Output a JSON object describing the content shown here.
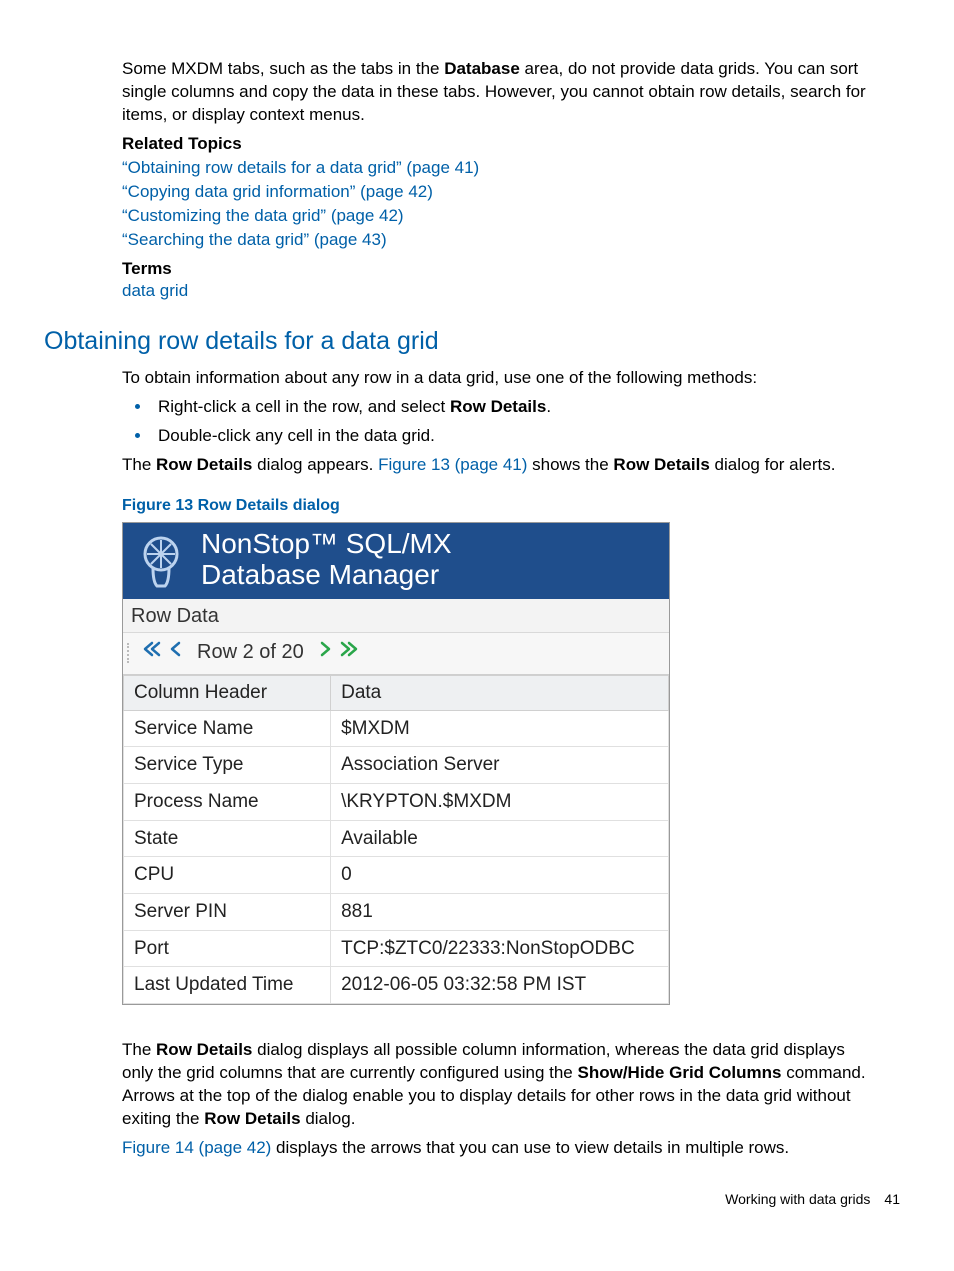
{
  "intro": {
    "p1_a": "Some MXDM tabs, such as the tabs in the ",
    "p1_bold": "Database",
    "p1_b": " area, do not provide data grids. You can sort single columns and copy the data in these tabs. However, you cannot obtain row details, search for items, or display context menus."
  },
  "related": {
    "heading": "Related Topics",
    "links": [
      "“Obtaining row details for a data grid” (page 41)",
      "“Copying data grid information” (page 42)",
      "“Customizing the data grid” (page 42)",
      "“Searching the data grid” (page 43)"
    ],
    "terms_heading": "Terms",
    "terms_link": "data grid"
  },
  "section": {
    "title": "Obtaining row details for a data grid",
    "lead": "To obtain information about any row in a data grid, use one of the following methods:",
    "methods": [
      {
        "a": "Right-click a cell in the row, and select ",
        "bold": "Row Details",
        "b": "."
      },
      {
        "a": "Double-click any cell in the data grid.",
        "bold": "",
        "b": ""
      }
    ],
    "appears_a": "The ",
    "appears_bold1": "Row Details",
    "appears_b": " dialog appears. ",
    "appears_link": "Figure 13 (page 41)",
    "appears_c": " shows the ",
    "appears_bold2": "Row Details",
    "appears_d": " dialog for alerts."
  },
  "figure": {
    "caption": "Figure 13 Row Details dialog",
    "banner_line1": "NonStop™ SQL/MX",
    "banner_line2": "Database Manager",
    "rowdata_label": "Row Data",
    "row_counter": "Row 2 of 20",
    "table_headers": [
      "Column Header",
      "Data"
    ],
    "rows": [
      [
        "Service Name",
        "$MXDM"
      ],
      [
        "Service Type",
        "Association Server"
      ],
      [
        "Process Name",
        "\\KRYPTON.$MXDM"
      ],
      [
        "State",
        "Available"
      ],
      [
        "CPU",
        "0"
      ],
      [
        "Server PIN",
        "881"
      ],
      [
        "Port",
        "TCP:$ZTC0/22333:NonStopODBC"
      ],
      [
        "Last Updated Time",
        "2012-06-05 03:32:58 PM IST"
      ]
    ]
  },
  "after": {
    "p_a": "The ",
    "p_bold1": "Row Details",
    "p_b": " dialog displays all possible column information, whereas the data grid displays only the grid columns that are currently configured using the ",
    "p_bold2": "Show/Hide Grid Columns",
    "p_c": " command. Arrows at the top of the dialog enable you to display details for other rows in the data grid without exiting the ",
    "p_bold3": "Row Details",
    "p_d": " dialog.",
    "p2_link": "Figure 14 (page 42)",
    "p2_b": " displays the arrows that you can use to view details in multiple rows."
  },
  "footer": {
    "label": "Working with data grids",
    "page": "41"
  }
}
